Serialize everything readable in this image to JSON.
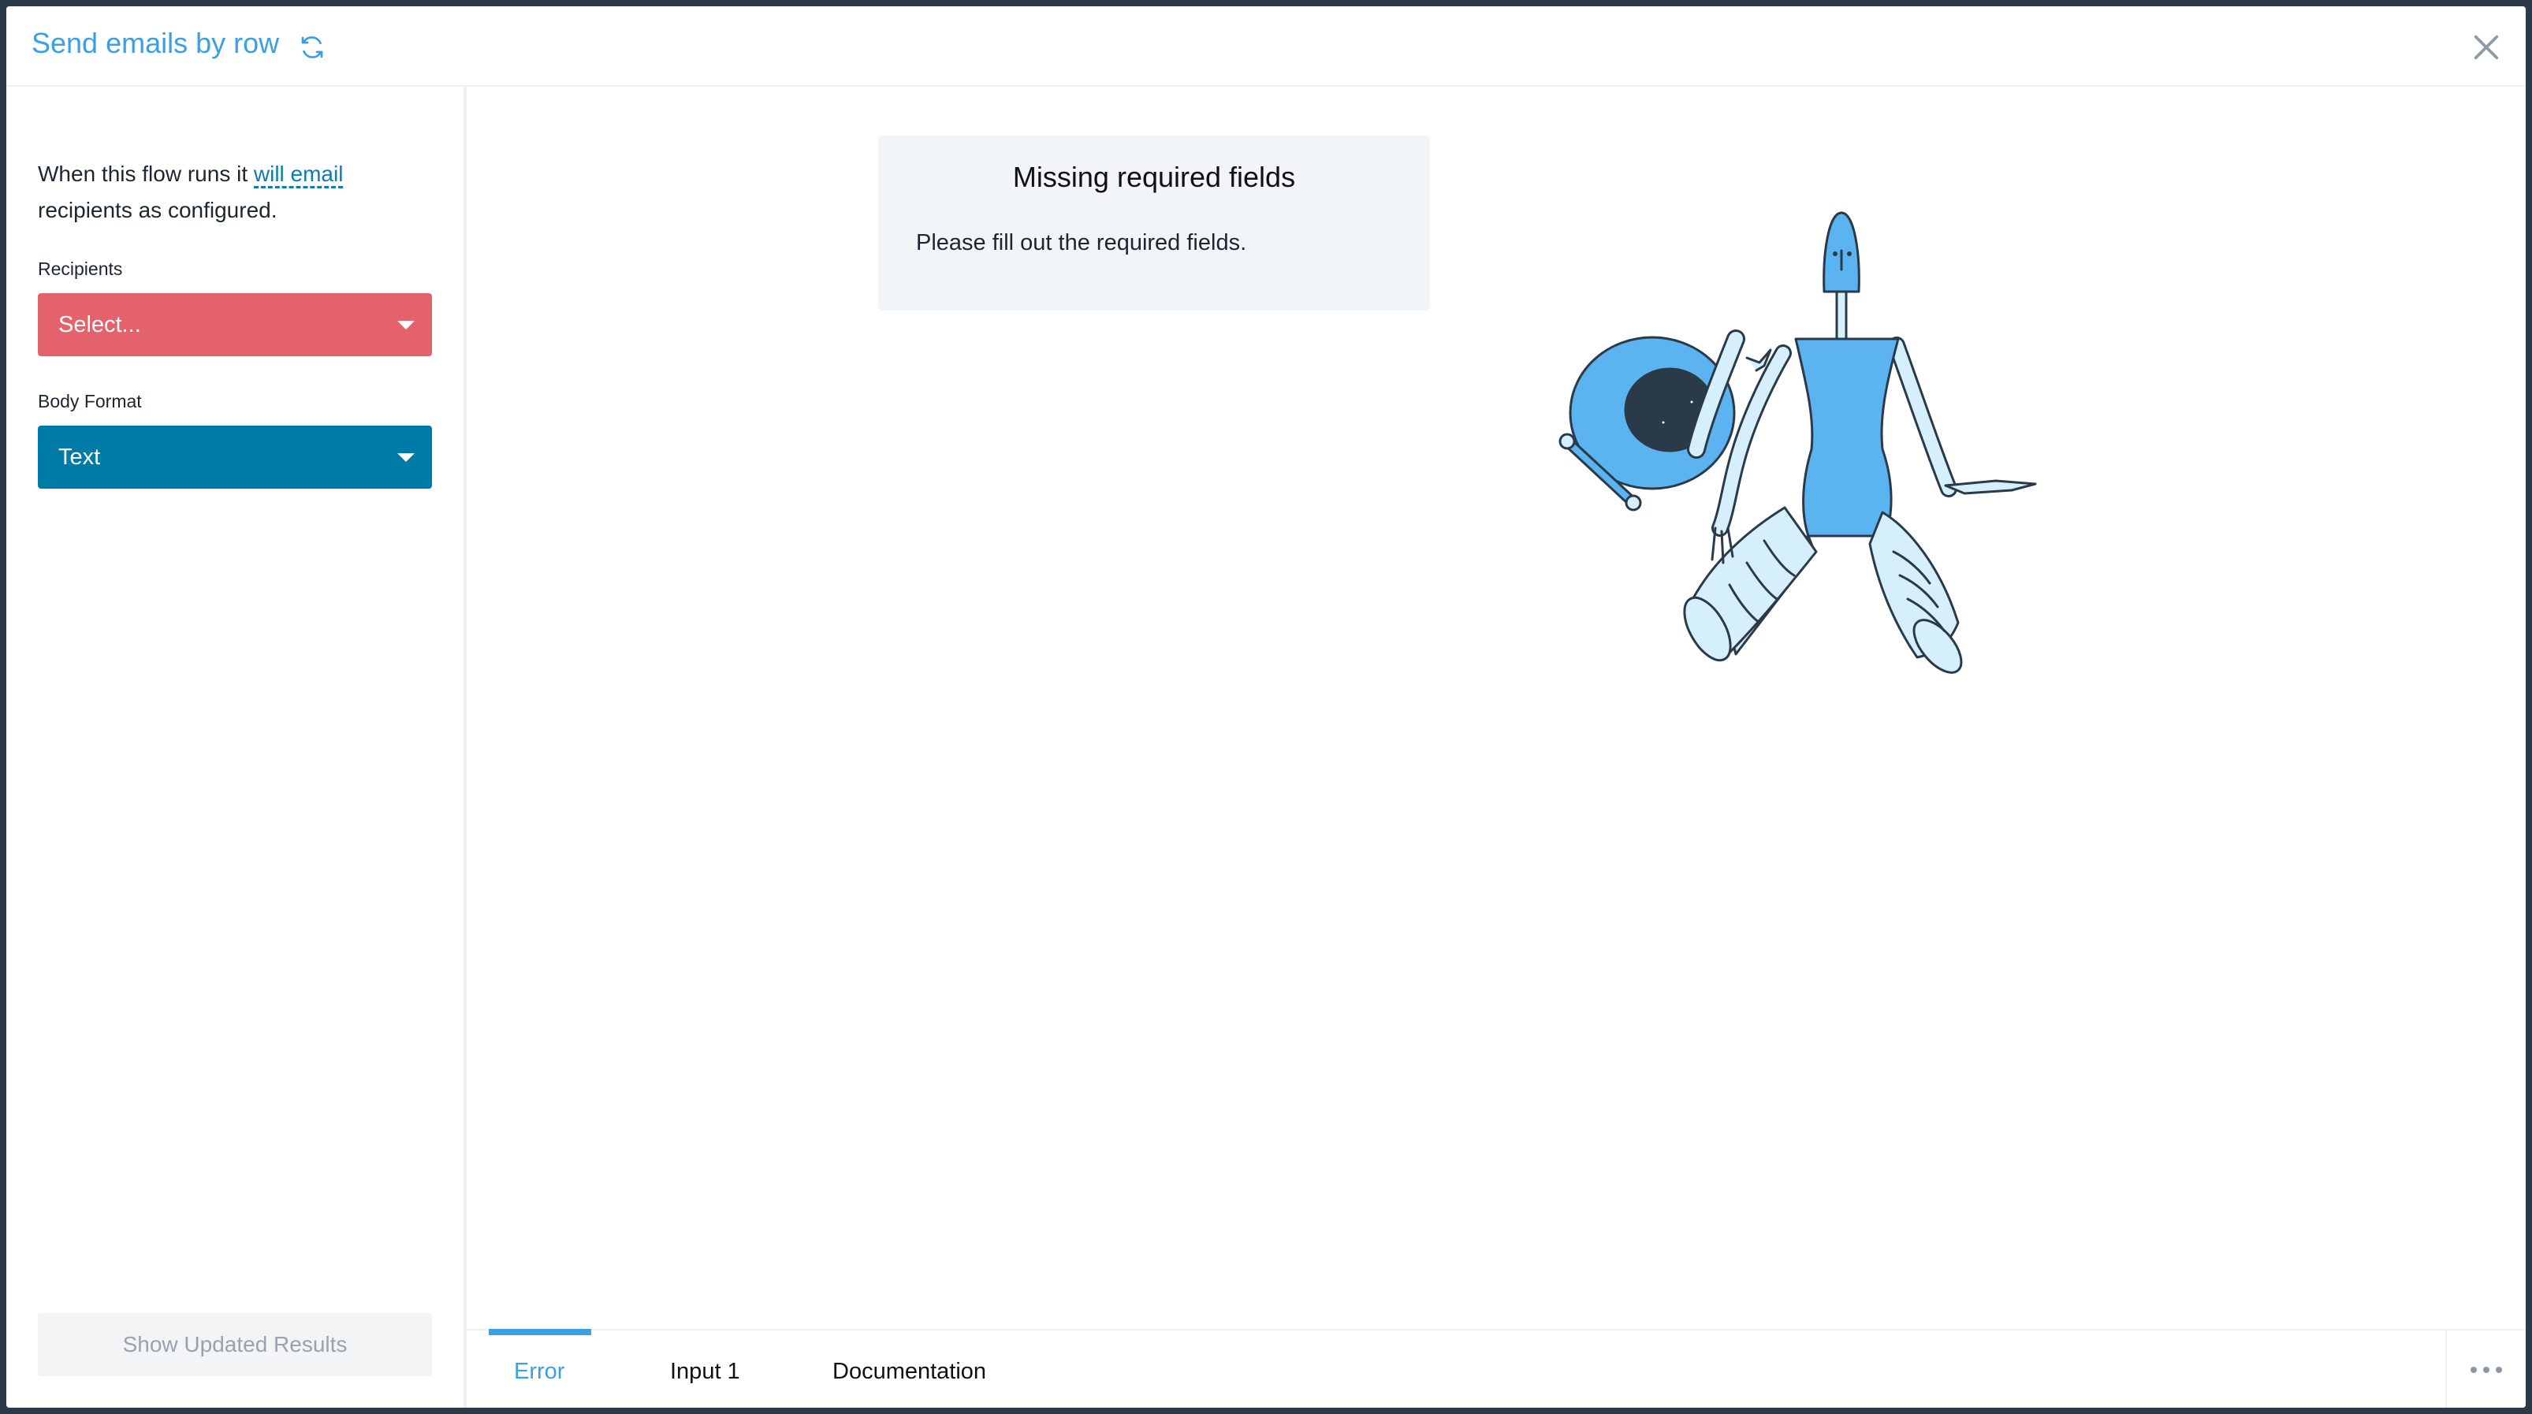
{
  "header": {
    "title": "Send emails by row",
    "refresh_icon": "refresh-icon",
    "close_icon": "close-icon"
  },
  "sidebar": {
    "intro_prefix": "When this flow runs it ",
    "intro_link": "will email",
    "intro_suffix": " recipients as configured.",
    "recipients_label": "Recipients",
    "recipients_value": "Select...",
    "body_format_label": "Body Format",
    "body_format_value": "Text",
    "show_results_label": "Show Updated Results"
  },
  "main": {
    "error_title": "Missing required fields",
    "error_message": "Please fill out the required fields."
  },
  "tabs": [
    {
      "label": "Error",
      "active": true
    },
    {
      "label": "Input 1",
      "active": false
    },
    {
      "label": "Documentation",
      "active": false
    }
  ],
  "colors": {
    "accent": "#3aa0e4",
    "error_select": "#e4626c",
    "format_select": "#007aa6",
    "robot_blue": "#5bb3ef",
    "robot_light": "#d6effc",
    "robot_outline": "#2b3a48"
  }
}
